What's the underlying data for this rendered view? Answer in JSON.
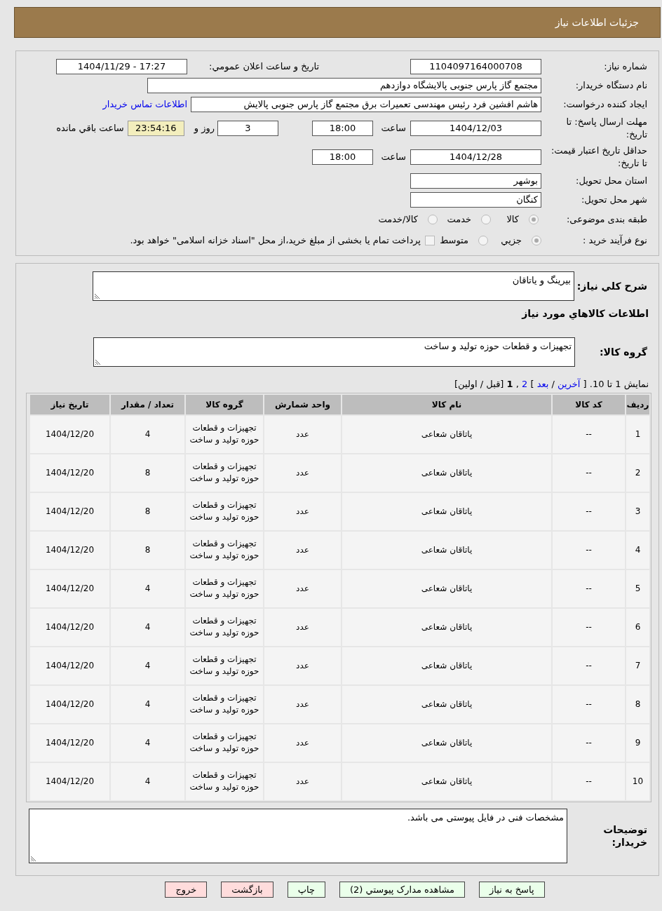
{
  "header": {
    "title": "جزئیات اطلاعات نیاز"
  },
  "need_number": {
    "label": "شماره نیاز:",
    "value": "1104097164000708"
  },
  "announce": {
    "label": "تاریخ و ساعت اعلان عمومي:",
    "value": "1404/11/29 - 17:27"
  },
  "buyer": {
    "label": "نام دستگاه خریدار:",
    "value": "مجتمع گاز پارس جنوبی  پالایشگاه دوازدهم"
  },
  "requester": {
    "label": "ایجاد کننده درخواست:",
    "value": "هاشم افشین فرد رئیس مهندسی تعمیرات برق مجتمع گاز پارس جنوبی  پالایش",
    "contact_link": "اطلاعات تماس خریدار"
  },
  "deadline": {
    "label": "مهلت ارسال پاسخ: تا تاریخ:",
    "date": "1404/12/03",
    "time_label": "ساعت",
    "time": "18:00",
    "days": "3",
    "days_label": "روز و",
    "remaining": "23:54:16",
    "remaining_label": "ساعت باقي مانده"
  },
  "validity": {
    "label": "حداقل تاریخ اعتبار قیمت: تا تاریخ:",
    "date": "1404/12/28",
    "time_label": "ساعت",
    "time": "18:00"
  },
  "province": {
    "label": "استان محل تحویل:",
    "value": "بوشهر"
  },
  "city": {
    "label": "شهر محل تحویل:",
    "value": "کنگان"
  },
  "category": {
    "label": "طبقه بندی موضوعی:",
    "options": [
      {
        "label": "کالا",
        "selected": true
      },
      {
        "label": "خدمت",
        "selected": false
      },
      {
        "label": "کالا/خدمت",
        "selected": false
      }
    ]
  },
  "purchase_type": {
    "label": "نوع فرآیند خرید :",
    "options": [
      {
        "label": "جزيي",
        "selected": true
      },
      {
        "label": "متوسط",
        "selected": false
      }
    ],
    "payment": {
      "checked": false,
      "label": "پرداخت تمام یا بخشی از مبلغ خرید،از محل \"اسناد خزانه اسلامی\" خواهد بود."
    }
  },
  "description": {
    "label": "شرح كلي نیاز:",
    "value": "بیرینگ و یاتاقان"
  },
  "goods_heading": "اطلاعات كالاهاي مورد نیاز",
  "goods_group": {
    "label": "گروه کالا:",
    "value": "تجهیزات و قطعات حوزه تولید و ساخت"
  },
  "pagination": [
    {
      "kind": "text",
      "text": "نمایش 1 تا 10. ["
    },
    {
      "kind": "link",
      "text": "آخرین"
    },
    {
      "kind": "text",
      "text": "/"
    },
    {
      "kind": "link",
      "text": "بعد"
    },
    {
      "kind": "text",
      "text": "]"
    },
    {
      "kind": "link",
      "text": "2"
    },
    {
      "kind": "text",
      "text": ","
    },
    {
      "kind": "current",
      "text": "1"
    },
    {
      "kind": "text",
      "text": "[قبل / اولین]"
    }
  ],
  "table": {
    "columns": [
      "ردیف",
      "کد کالا",
      "نام کالا",
      "واحد شمارش",
      "گروه کالا",
      "تعداد / مقدار",
      "تاریخ نیاز"
    ],
    "rows": [
      [
        "1",
        "--",
        "یاتاقان شعاعی",
        "عدد",
        "تجهیزات و قطعات حوزه تولید و ساخت",
        "4",
        "1404/12/20"
      ],
      [
        "2",
        "--",
        "یاتاقان شعاعی",
        "عدد",
        "تجهیزات و قطعات حوزه تولید و ساخت",
        "8",
        "1404/12/20"
      ],
      [
        "3",
        "--",
        "یاتاقان شعاعی",
        "عدد",
        "تجهیزات و قطعات حوزه تولید و ساخت",
        "8",
        "1404/12/20"
      ],
      [
        "4",
        "--",
        "یاتاقان شعاعی",
        "عدد",
        "تجهیزات و قطعات حوزه تولید و ساخت",
        "8",
        "1404/12/20"
      ],
      [
        "5",
        "--",
        "یاتاقان شعاعی",
        "عدد",
        "تجهیزات و قطعات حوزه تولید و ساخت",
        "4",
        "1404/12/20"
      ],
      [
        "6",
        "--",
        "یاتاقان شعاعی",
        "عدد",
        "تجهیزات و قطعات حوزه تولید و ساخت",
        "4",
        "1404/12/20"
      ],
      [
        "7",
        "--",
        "یاتاقان شعاعی",
        "عدد",
        "تجهیزات و قطعات حوزه تولید و ساخت",
        "4",
        "1404/12/20"
      ],
      [
        "8",
        "--",
        "یاتاقان شعاعی",
        "عدد",
        "تجهیزات و قطعات حوزه تولید و ساخت",
        "4",
        "1404/12/20"
      ],
      [
        "9",
        "--",
        "یاتاقان شعاعی",
        "عدد",
        "تجهیزات و قطعات حوزه تولید و ساخت",
        "4",
        "1404/12/20"
      ],
      [
        "10",
        "--",
        "یاتاقان شعاعی",
        "عدد",
        "تجهیزات و قطعات حوزه تولید و ساخت",
        "4",
        "1404/12/20"
      ]
    ]
  },
  "buyer_notes": {
    "label": "توضیحات خریدار:",
    "value": "مشخصات فنی در فایل پیوستی می باشد."
  },
  "buttons": [
    {
      "label": "پاسخ به نیاز",
      "kind": "normal"
    },
    {
      "label": "مشاهده مدارک پیوستي (2)",
      "kind": "normal"
    },
    {
      "label": "چاپ",
      "kind": "normal"
    },
    {
      "label": "بازگشت",
      "kind": "exit"
    },
    {
      "label": "خروج",
      "kind": "exit"
    }
  ]
}
